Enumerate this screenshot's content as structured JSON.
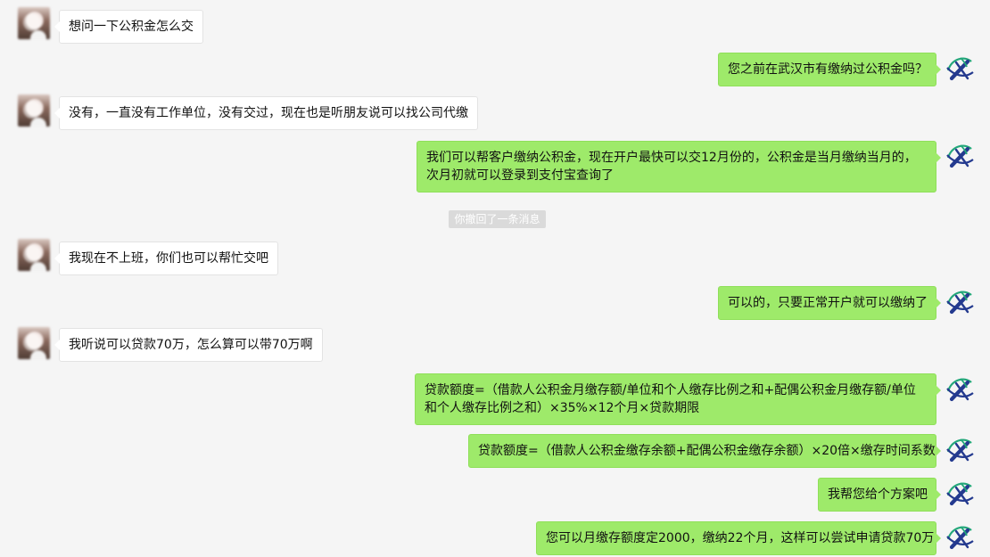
{
  "chat": {
    "messages": [
      {
        "id": "m1",
        "side": "left",
        "text": "想问一下公积金怎么交"
      },
      {
        "id": "m2",
        "side": "right",
        "text": "您之前在武汉市有缴纳过公积金吗？"
      },
      {
        "id": "m3",
        "side": "left",
        "text": "没有，一直没有工作单位，没有交过，现在也是听朋友说可以找公司代缴"
      },
      {
        "id": "m4",
        "side": "right",
        "text": "我们可以帮客户缴纳公积金，现在开户最快可以交12月份的，公积金是当月缴纳当月的，次月初就可以登录到支付宝查询了"
      },
      {
        "id": "m5",
        "side": "left",
        "text": "我现在不上班，你们也可以帮忙交吧"
      },
      {
        "id": "m6",
        "side": "right",
        "text": "可以的，只要正常开户就可以缴纳了"
      },
      {
        "id": "m7",
        "side": "left",
        "text": "我听说可以贷款70万，怎么算可以带70万啊"
      },
      {
        "id": "m8",
        "side": "right",
        "text": "贷款额度=（借款人公积金月缴存额/单位和个人缴存比例之和+配偶公积金月缴存额/单位和个人缴存比例之和）×35%×12个月×贷款期限"
      },
      {
        "id": "m9",
        "side": "right",
        "text": "贷款额度=（借款人公积金缴存余额+配偶公积金缴存余额）×20倍×缴存时间系数"
      },
      {
        "id": "m10",
        "side": "right",
        "text": "我帮您给个方案吧"
      },
      {
        "id": "m11",
        "side": "right",
        "text": "您可以月缴存额度定2000，缴纳22个月，这样可以尝试申请贷款70万"
      }
    ],
    "system_notice": "你撤回了一条消息"
  },
  "icons": {
    "right_avatar": "company-logo-icon",
    "left_avatar": "user-avatar-icon"
  },
  "colors": {
    "background": "#f5f5f5",
    "sent_bubble": "#9eea6a",
    "received_bubble": "#ffffff",
    "system_notice_bg": "#dadada",
    "logo_blue": "#243a8f",
    "logo_green": "#23a77a"
  }
}
